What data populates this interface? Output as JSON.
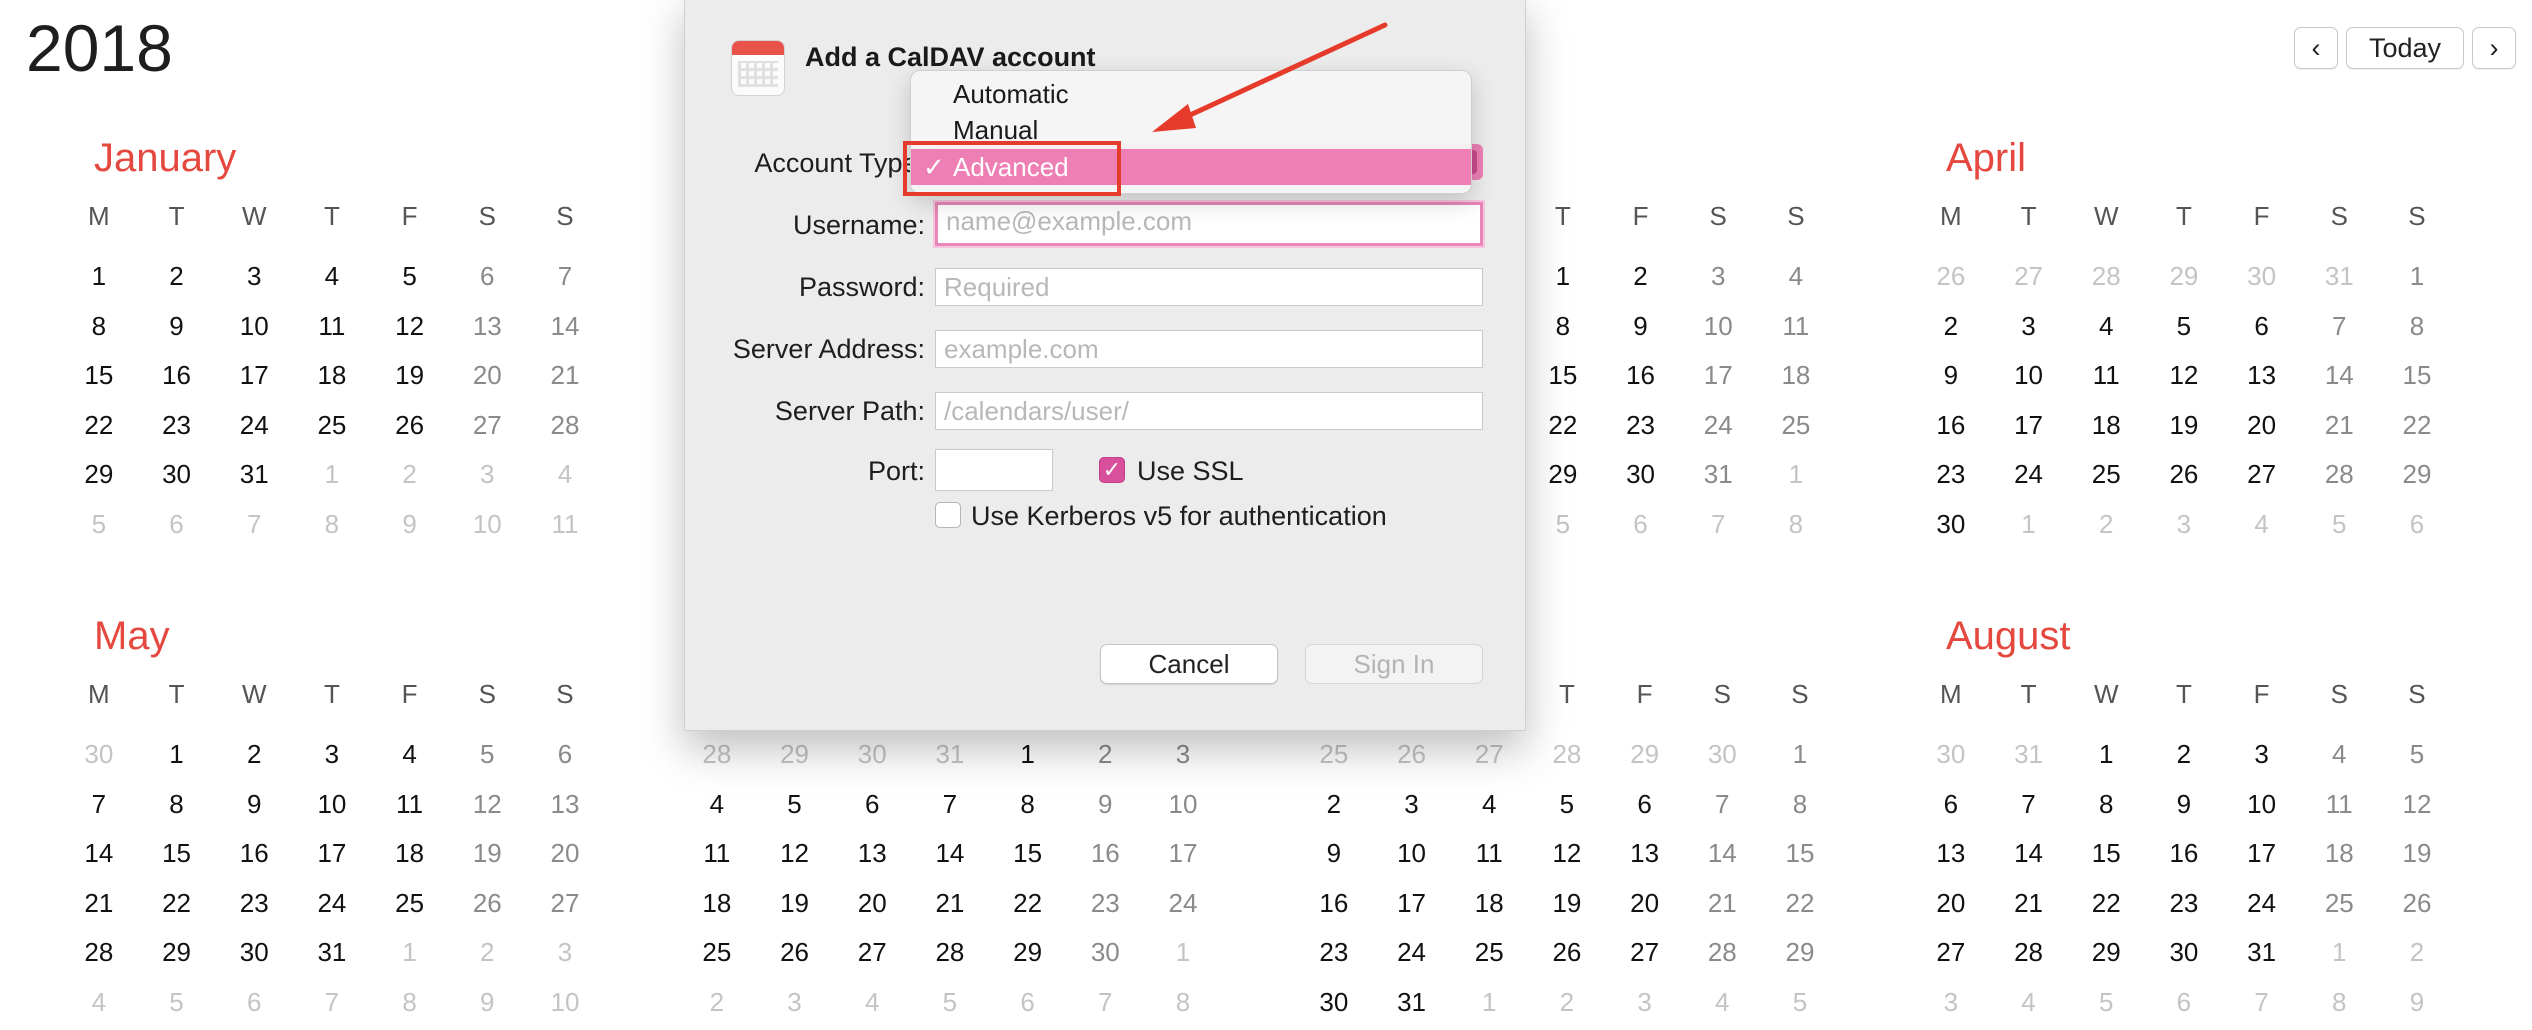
{
  "header": {
    "year": "2018"
  },
  "nav": {
    "prev_icon": "‹",
    "today_label": "Today",
    "next_icon": "›"
  },
  "dow": [
    "M",
    "T",
    "W",
    "T",
    "F",
    "S",
    "S"
  ],
  "months": [
    {
      "name": "January",
      "weeks": [
        [
          "",
          "",
          "",
          "",
          "",
          "",
          ""
        ],
        [
          "1",
          "2",
          "3",
          "4",
          "5",
          "6",
          "7"
        ],
        [
          "8",
          "9",
          "10",
          "11",
          "12",
          "13",
          "14"
        ],
        [
          "15",
          "16",
          "17",
          "18",
          "19",
          "20",
          "21"
        ],
        [
          "22",
          "23",
          "24",
          "25",
          "26",
          "27",
          "28"
        ],
        [
          "29",
          "30",
          "31",
          "1",
          "2",
          "3",
          "4"
        ],
        [
          "5",
          "6",
          "7",
          "8",
          "9",
          "10",
          "11"
        ]
      ]
    },
    {
      "name": "",
      "weeks": []
    },
    {
      "name": "",
      "weeks": [
        [
          "",
          "",
          "",
          "",
          "",
          "",
          ""
        ],
        [
          "",
          "",
          "",
          "",
          "",
          "",
          ""
        ],
        [
          "",
          "",
          "",
          "",
          "",
          "",
          ""
        ],
        [
          "",
          "",
          "",
          "",
          "",
          "",
          ""
        ],
        [
          "",
          "",
          "",
          "",
          "",
          "",
          ""
        ],
        [
          "",
          "",
          "",
          "",
          "",
          "",
          ""
        ]
      ]
    },
    {
      "name": "April",
      "weeks": [
        [
          "26",
          "27",
          "28",
          "29",
          "30",
          "31",
          "1"
        ],
        [
          "2",
          "3",
          "4",
          "5",
          "6",
          "7",
          "8"
        ],
        [
          "9",
          "10",
          "11",
          "12",
          "13",
          "14",
          "15"
        ],
        [
          "16",
          "17",
          "18",
          "19",
          "20",
          "21",
          "22"
        ],
        [
          "23",
          "24",
          "25",
          "26",
          "27",
          "28",
          "29"
        ],
        [
          "30",
          "1",
          "2",
          "3",
          "4",
          "5",
          "6"
        ]
      ]
    },
    {
      "name": "May",
      "weeks": [
        [
          "30",
          "1",
          "2",
          "3",
          "4",
          "5",
          "6"
        ],
        [
          "7",
          "8",
          "9",
          "10",
          "11",
          "12",
          "13"
        ],
        [
          "14",
          "15",
          "16",
          "17",
          "18",
          "19",
          "20"
        ],
        [
          "21",
          "22",
          "23",
          "24",
          "25",
          "26",
          "27"
        ],
        [
          "28",
          "29",
          "30",
          "31",
          "1",
          "2",
          "3"
        ],
        [
          "4",
          "5",
          "6",
          "7",
          "8",
          "9",
          "10"
        ]
      ]
    },
    {
      "name": "",
      "weeks": [
        [
          "28",
          "29",
          "30",
          "31",
          "1",
          "2",
          "3"
        ],
        [
          "4",
          "5",
          "6",
          "7",
          "8",
          "9",
          "10"
        ],
        [
          "11",
          "12",
          "13",
          "14",
          "15",
          "16",
          "17"
        ],
        [
          "18",
          "19",
          "20",
          "21",
          "22",
          "23",
          "24"
        ],
        [
          "25",
          "26",
          "27",
          "28",
          "29",
          "30",
          "1"
        ],
        [
          "2",
          "3",
          "4",
          "5",
          "6",
          "7",
          "8"
        ]
      ]
    },
    {
      "name": "",
      "weeks": [
        [
          "25",
          "26",
          "27",
          "28",
          "29",
          "30",
          "1"
        ],
        [
          "2",
          "3",
          "4",
          "5",
          "6",
          "7",
          "8"
        ],
        [
          "9",
          "10",
          "11",
          "12",
          "13",
          "14",
          "15"
        ],
        [
          "16",
          "17",
          "18",
          "19",
          "20",
          "21",
          "22"
        ],
        [
          "23",
          "24",
          "25",
          "26",
          "27",
          "28",
          "29"
        ],
        [
          "30",
          "31",
          "1",
          "2",
          "3",
          "4",
          "5"
        ]
      ]
    },
    {
      "name": "August",
      "weeks": [
        [
          "30",
          "31",
          "1",
          "2",
          "3",
          "4",
          "5"
        ],
        [
          "6",
          "7",
          "8",
          "9",
          "10",
          "11",
          "12"
        ],
        [
          "13",
          "14",
          "15",
          "16",
          "17",
          "18",
          "19"
        ],
        [
          "20",
          "21",
          "22",
          "23",
          "24",
          "25",
          "26"
        ],
        [
          "27",
          "28",
          "29",
          "30",
          "31",
          "1",
          "2"
        ],
        [
          "3",
          "4",
          "5",
          "6",
          "7",
          "8",
          "9"
        ]
      ]
    }
  ],
  "march_partial": {
    "dow": [
      "T",
      "F",
      "S",
      "S"
    ],
    "weeks": [
      [
        "1",
        "2",
        "3",
        "4"
      ],
      [
        "8",
        "9",
        "10",
        "11"
      ],
      [
        "15",
        "16",
        "17",
        "18"
      ],
      [
        "22",
        "23",
        "24",
        "25"
      ],
      [
        "29",
        "30",
        "31",
        "1"
      ],
      [
        "5",
        "6",
        "7",
        "8"
      ]
    ]
  },
  "dialog": {
    "title": "Add a CalDAV account",
    "account_type_label": "Account Type:",
    "username_label": "Username:",
    "username_placeholder": "name@example.com",
    "password_label": "Password:",
    "password_placeholder": "Required",
    "server_address_label": "Server Address:",
    "server_address_placeholder": "example.com",
    "server_path_label": "Server Path:",
    "server_path_placeholder": "/calendars/user/",
    "port_label": "Port:",
    "use_ssl_label": "Use SSL",
    "kerberos_label": "Use Kerberos v5 for authentication",
    "cancel_label": "Cancel",
    "sign_in_label": "Sign In"
  },
  "account_type_menu": {
    "options": [
      "Automatic",
      "Manual",
      "Advanced"
    ],
    "selected": "Advanced",
    "check_glyph": "✓"
  },
  "colors": {
    "accent": "#ee7fb5",
    "month_red": "#e5483e",
    "annotation": "#e63a2a"
  }
}
